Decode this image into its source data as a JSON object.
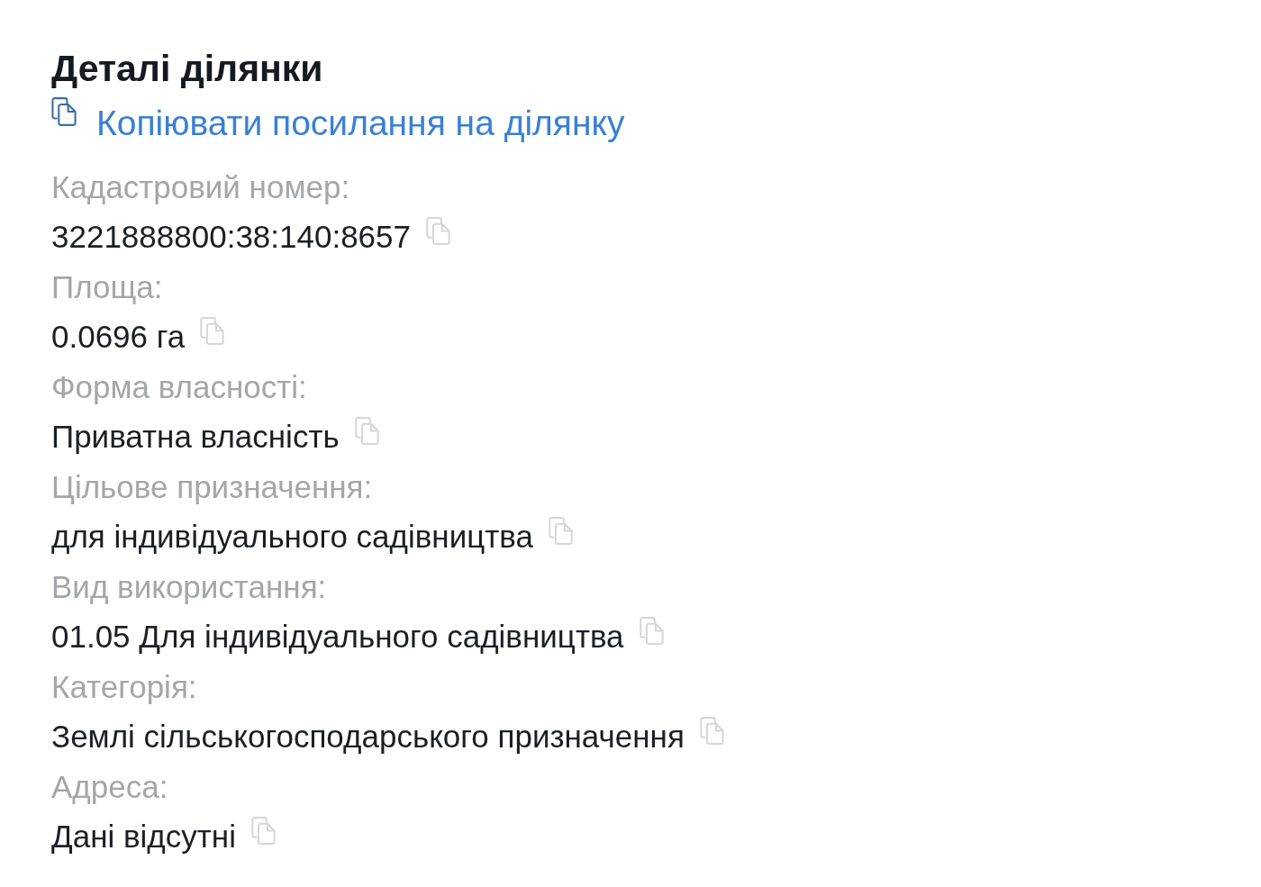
{
  "title": "Деталі ділянки",
  "copy_link": {
    "label": "Копіювати посилання на ділянку"
  },
  "fields": [
    {
      "label": "Кадастровий номер:",
      "value": "3221888800:38:140:8657"
    },
    {
      "label": "Площа:",
      "value": "0.0696 га"
    },
    {
      "label": "Форма власності:",
      "value": "Приватна власність"
    },
    {
      "label": "Цільове призначення:",
      "value": "для індивідуального садівництва"
    },
    {
      "label": "Вид використання:",
      "value": "01.05 Для індивідуального садівництва"
    },
    {
      "label": "Категорія:",
      "value": "Землі сільськогосподарського призначення"
    },
    {
      "label": "Адреса:",
      "value": "Дані відсутні"
    }
  ]
}
